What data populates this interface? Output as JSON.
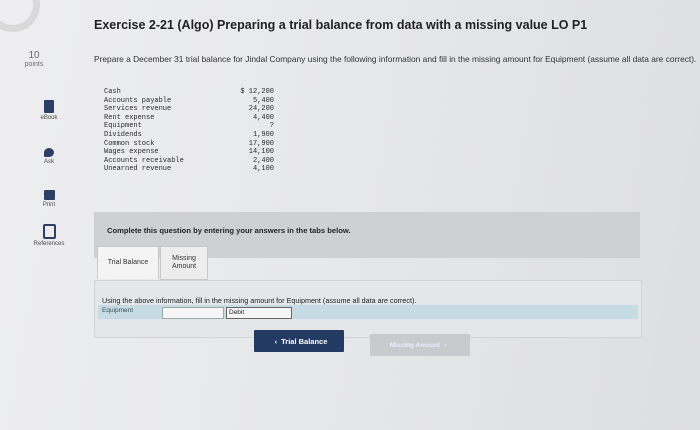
{
  "sidebar": {
    "points_value": "10",
    "points_label": "points",
    "items": [
      {
        "label": "eBook",
        "icon": "book-icon"
      },
      {
        "label": "Ask",
        "icon": "chat-icon"
      },
      {
        "label": "Print",
        "icon": "print-icon"
      },
      {
        "label": "References",
        "icon": "references-icon"
      }
    ]
  },
  "header": {
    "title": "Exercise 2-21 (Algo) Preparing a trial balance from data with a missing value LO P1"
  },
  "instructions": "Prepare a December 31 trial balance for Jindal Company using the following information and fill in the missing amount for Equipment (assume all data are correct).",
  "accounts": [
    {
      "name": "Cash",
      "value": "$ 12,200"
    },
    {
      "name": "Accounts payable",
      "value": "5,400"
    },
    {
      "name": "Services revenue",
      "value": "24,200"
    },
    {
      "name": "Rent expense",
      "value": "4,400"
    },
    {
      "name": "Equipment",
      "value": "?"
    },
    {
      "name": "Dividends",
      "value": "1,900"
    },
    {
      "name": "Common stock",
      "value": "17,900"
    },
    {
      "name": "Wages expense",
      "value": "14,100"
    },
    {
      "name": "Accounts receivable",
      "value": "2,400"
    },
    {
      "name": "Unearned revenue",
      "value": "4,100"
    }
  ],
  "complete_text": "Complete this question by entering your answers in the tabs below.",
  "tabs": [
    {
      "label": "Trial Balance"
    },
    {
      "label": "Missing Amount"
    }
  ],
  "question": "Using the above information, fill in the missing amount for Equipment (assume all data are correct).",
  "answer": {
    "label": "Equipment",
    "value": "",
    "side": "Debit"
  },
  "nav": {
    "prev": "Trial Balance",
    "next": "Missing Amount"
  }
}
